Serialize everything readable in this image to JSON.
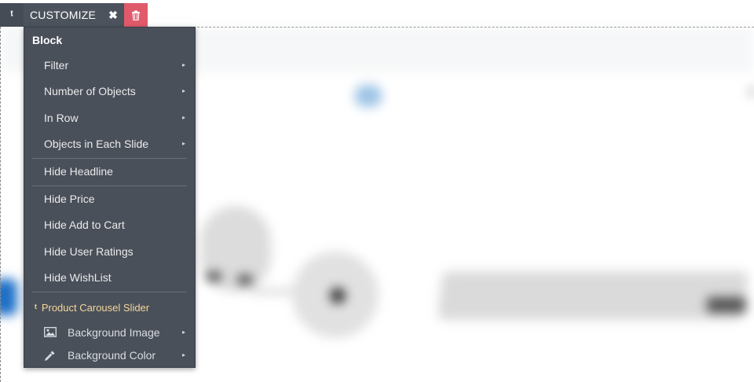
{
  "toolbar": {
    "up_icon": "ᵗ",
    "customize_label": "CUSTOMIZE",
    "close_icon": "✖",
    "delete_color": "#e05a6b"
  },
  "menu": {
    "title": "Block",
    "items": [
      {
        "label": "Filter",
        "has_submenu": true
      },
      {
        "label": "Number of Objects",
        "has_submenu": true
      },
      {
        "label": "In Row",
        "has_submenu": true
      },
      {
        "label": "Objects in Each Slide",
        "has_submenu": true
      },
      {
        "label": "Hide Headline",
        "has_submenu": false
      },
      {
        "label": "Hide Price",
        "has_submenu": false
      },
      {
        "label": "Hide Add to Cart",
        "has_submenu": false
      },
      {
        "label": "Hide User Ratings",
        "has_submenu": false
      },
      {
        "label": "Hide WishList",
        "has_submenu": false
      }
    ],
    "parent_label": "Product Carousel Slider",
    "sub_items": [
      {
        "label": "Background Image",
        "icon": "image-icon"
      },
      {
        "label": "Background Color",
        "icon": "eyedropper-icon"
      }
    ],
    "submenu_arrow": "▸"
  }
}
